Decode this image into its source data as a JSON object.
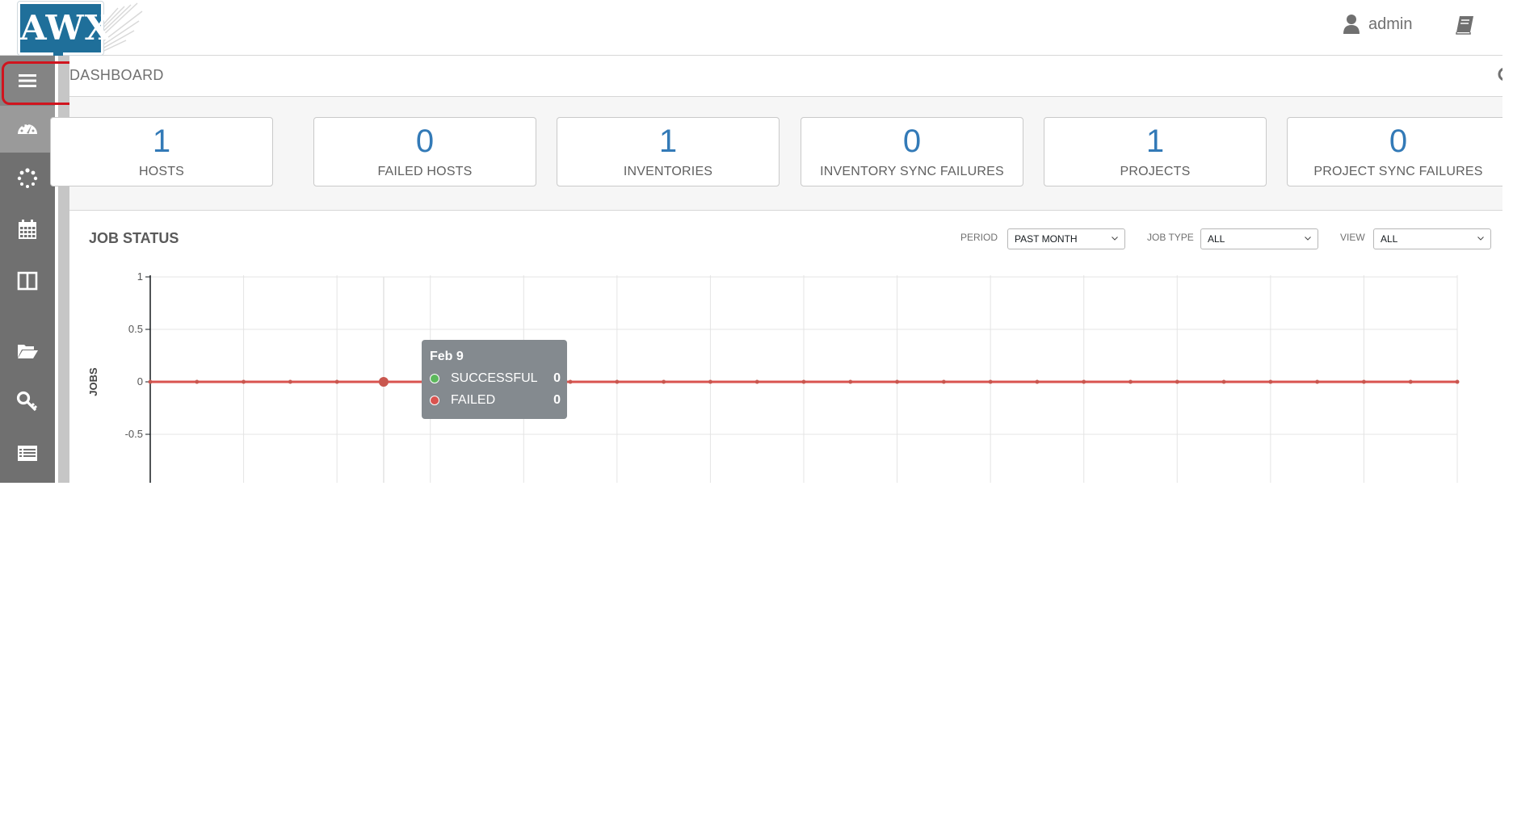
{
  "header": {
    "logo_text": "AWX",
    "user_name": "admin"
  },
  "breadcrumb": "DASHBOARD",
  "counts": [
    {
      "value": "1",
      "label": "HOSTS"
    },
    {
      "value": "0",
      "label": "FAILED HOSTS"
    },
    {
      "value": "1",
      "label": "INVENTORIES"
    },
    {
      "value": "0",
      "label": "INVENTORY SYNC FAILURES"
    },
    {
      "value": "1",
      "label": "PROJECTS"
    },
    {
      "value": "0",
      "label": "PROJECT SYNC FAILURES"
    }
  ],
  "job_status": {
    "title": "JOB STATUS",
    "filters": {
      "period": {
        "label": "PERIOD",
        "value": "PAST MONTH"
      },
      "job_type": {
        "label": "JOB TYPE",
        "value": "ALL"
      },
      "view": {
        "label": "VIEW",
        "value": "ALL"
      }
    }
  },
  "tooltip": {
    "date": "Feb 9",
    "rows": [
      {
        "label": "SUCCESSFUL",
        "value": "0",
        "color": "#5cb85c"
      },
      {
        "label": "FAILED",
        "value": "0",
        "color": "#d9534f"
      }
    ]
  },
  "chart_data": {
    "type": "line",
    "ylabel": "JOBS",
    "y_ticks": [
      "1",
      "0.5",
      "0",
      "-0.5"
    ],
    "ylim": [
      -1,
      1
    ],
    "grid": true,
    "series": [
      {
        "name": "SUCCESSFUL",
        "color": "#5cb85c",
        "values": [
          0,
          0,
          0,
          0,
          0,
          0,
          0,
          0,
          0,
          0,
          0,
          0,
          0,
          0,
          0,
          0,
          0,
          0,
          0,
          0,
          0,
          0,
          0,
          0,
          0,
          0,
          0,
          0,
          0
        ]
      },
      {
        "name": "FAILED",
        "color": "#d9534f",
        "values": [
          0,
          0,
          0,
          0,
          0,
          0,
          0,
          0,
          0,
          0,
          0,
          0,
          0,
          0,
          0,
          0,
          0,
          0,
          0,
          0,
          0,
          0,
          0,
          0,
          0,
          0,
          0,
          0,
          0
        ]
      }
    ],
    "highlight_index": 5
  },
  "colors": {
    "accent": "#337ab7",
    "sidebar": "#707070",
    "highlight": "#d0141e",
    "failed": "#d9534f",
    "successful": "#5cb85c"
  },
  "icons": {
    "menu": "hamburger-icon",
    "dashboard": "dashboard-gauge-icon",
    "jobs": "spinner-icon",
    "schedules": "calendar-icon",
    "portal": "columns-icon",
    "projects": "folder-open-icon",
    "credentials": "key-icon",
    "inventories": "list-icon",
    "user": "user-icon",
    "docs": "book-icon"
  }
}
